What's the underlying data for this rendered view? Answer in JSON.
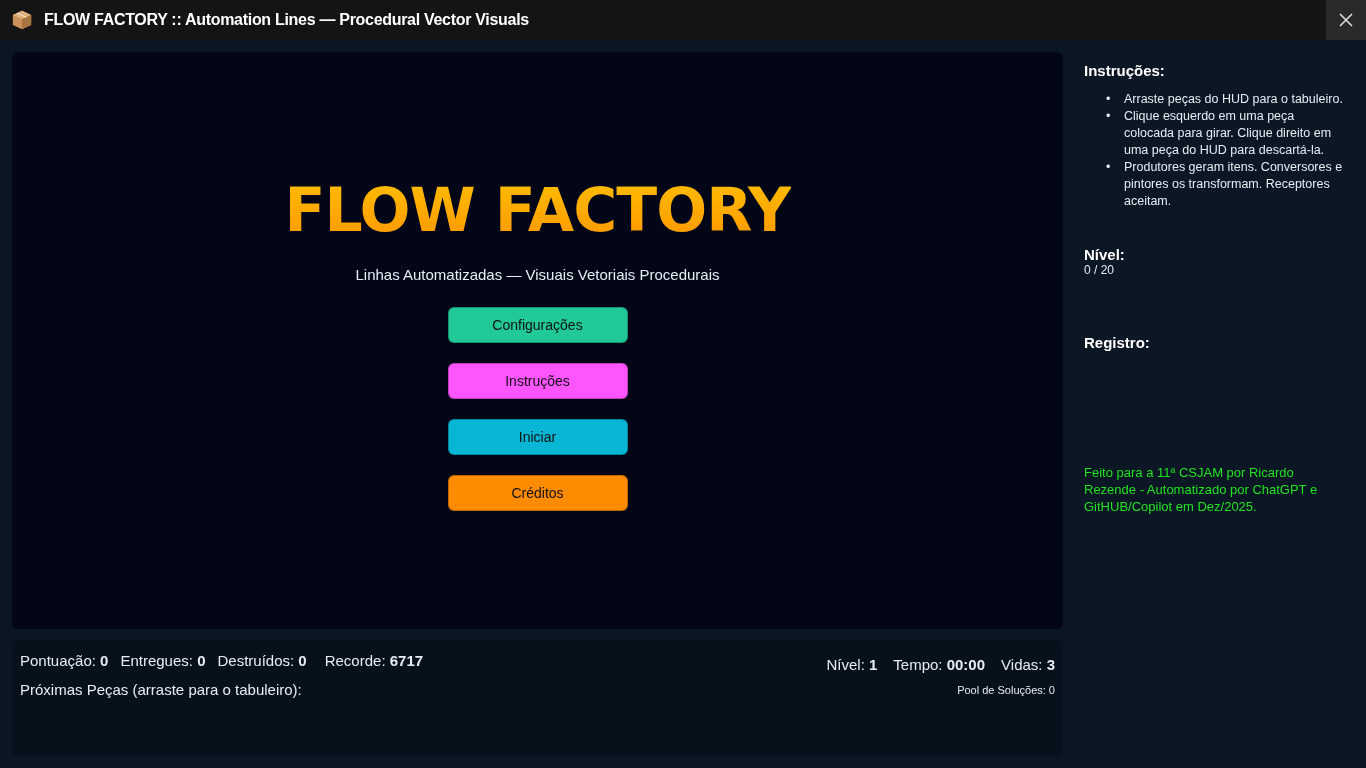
{
  "window": {
    "title": "FLOW FACTORY :: Automation Lines — Procedural Vector Visuals"
  },
  "menu": {
    "title": "FLOW FACTORY",
    "subtitle": "Linhas Automatizadas — Visuais Vetoriais Procedurais",
    "buttons": [
      {
        "label": "Configurações",
        "color": "#20c997"
      },
      {
        "label": "Instruções",
        "color": "#ff55ff"
      },
      {
        "label": "Iniciar",
        "color": "#06b6d4"
      },
      {
        "label": "Créditos",
        "color": "#ff8c00"
      }
    ]
  },
  "hud": {
    "stats_left": [
      {
        "label": "Pontuação:",
        "value": "0"
      },
      {
        "label": "Entregues:",
        "value": "0"
      },
      {
        "label": "Destruídos:",
        "value": "0"
      },
      {
        "label": "Recorde:",
        "value": "6717"
      }
    ],
    "stats_right": [
      {
        "label": "Nível:",
        "value": "1"
      },
      {
        "label": "Tempo:",
        "value": "00:00"
      },
      {
        "label": "Vidas:",
        "value": "3"
      }
    ],
    "next_pieces": "Próximas Peças (arraste para o tabuleiro):",
    "pool": "Pool de Soluções: 0"
  },
  "sidebar": {
    "instructions": {
      "title": "Instruções:",
      "items": [
        {
          "marker": "•",
          "text": "Arraste peças do HUD para o tabuleiro."
        },
        {
          "marker": "•",
          "text": "Clique esquerdo em uma peça colocada para girar. Clique direito em uma peça do HUD para descartá-la."
        },
        {
          "marker": "•",
          "text": "Produtores geram itens. Conversores e pintores os transformam. Receptores aceitam."
        }
      ]
    },
    "level": {
      "title": "Nível:",
      "value": "0 / 20"
    },
    "log": {
      "title": "Registro:"
    },
    "credits": "Feito para a 11ª CSJAM por Ricardo Rezende - Automatizado por ChatGPT e GitHUB/Copilot em Dez/2025."
  }
}
